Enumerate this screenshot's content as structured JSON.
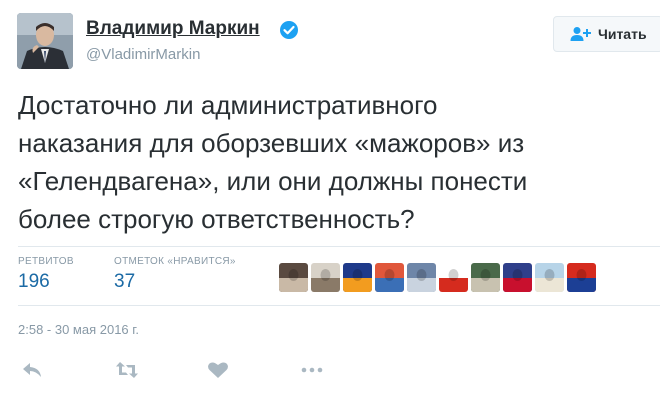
{
  "author": {
    "name": "Владимир Маркин",
    "handle": "@VladimirMarkin",
    "verified": true
  },
  "follow_button": {
    "label": "Читать",
    "icon": "add-user-icon"
  },
  "tweet": {
    "lines": [
      "Достаточно ли административного",
      "наказания для оборзевших «мажоров» из",
      "«Гелендвагена», или они должны понести",
      "более строгую ответственность?"
    ]
  },
  "stats": {
    "retweets_label": "РЕТВИТОВ",
    "retweets_count": "196",
    "likes_label": "ОТМЕТОК «НРАВИТСЯ»",
    "likes_count": "37"
  },
  "liker_avatars": [
    {
      "name": "liker-avatar-1",
      "colors": [
        "#5a4a40",
        "#c9b9a6"
      ]
    },
    {
      "name": "liker-avatar-2",
      "colors": [
        "#d8d2c8",
        "#8a7a68"
      ]
    },
    {
      "name": "liker-avatar-3",
      "colors": [
        "#1f3a8a",
        "#f29c1f"
      ]
    },
    {
      "name": "liker-avatar-4",
      "colors": [
        "#e0573b",
        "#3b6fb6"
      ]
    },
    {
      "name": "liker-avatar-5",
      "colors": [
        "#6e86a8",
        "#c9d3df"
      ]
    },
    {
      "name": "liker-avatar-6",
      "colors": [
        "#ffffff",
        "#d52b1e"
      ]
    },
    {
      "name": "liker-avatar-7",
      "colors": [
        "#4a6a4a",
        "#c8c2b0"
      ]
    },
    {
      "name": "liker-avatar-8",
      "colors": [
        "#2f3f8a",
        "#c8102e"
      ]
    },
    {
      "name": "liker-avatar-9",
      "colors": [
        "#b7d4e8",
        "#ece6d6"
      ]
    },
    {
      "name": "liker-avatar-10",
      "colors": [
        "#d52b1e",
        "#1c3f95"
      ]
    }
  ],
  "timestamp": "2:58 - 30 мая 2016 г.",
  "actions": [
    "reply-icon",
    "retweet-icon",
    "like-icon",
    "more-icon"
  ],
  "colors": {
    "text": "#292f33",
    "muted": "#8899a6",
    "count": "#1b6aa5",
    "verified": "#1da1f2",
    "divider": "#e1e8ed",
    "action_icon": "#aab8c2"
  }
}
